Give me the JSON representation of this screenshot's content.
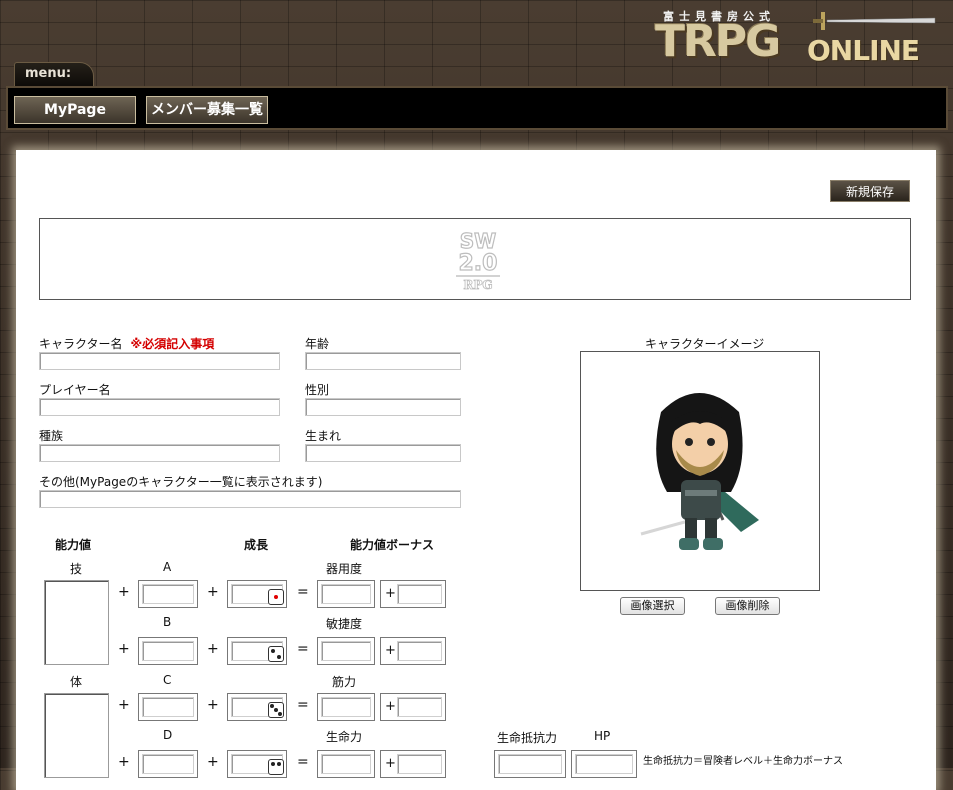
{
  "header": {
    "logo_sub": "富士見書房公式",
    "logo_main": "TRPG",
    "logo_online": "ONLINE",
    "menu_tab": "menu:"
  },
  "nav": {
    "mypage": "MyPage",
    "recruit": "メンバー募集一覧"
  },
  "toolbar": {
    "save_label": "新規保存"
  },
  "banner": {
    "sw_logo_text": "SW 2.0 RPG"
  },
  "form": {
    "character_name": "キャラクター名",
    "required": "※必須記入事項",
    "age": "年齢",
    "player_name": "プレイヤー名",
    "gender": "性別",
    "race": "種族",
    "birth": "生まれ",
    "other": "その他(MyPageのキャラクター一覧に表示されます)"
  },
  "stats": {
    "heading_ability": "能力値",
    "heading_growth": "成長",
    "heading_bonus": "能力値ボーナス",
    "gi": "技",
    "tai": "体",
    "A": "A",
    "B": "B",
    "C": "C",
    "D": "D",
    "dexterity": "器用度",
    "agility": "敏捷度",
    "strength": "筋力",
    "vitality": "生命力",
    "plus": "+",
    "equals": "="
  },
  "image": {
    "title": "キャラクターイメージ",
    "select_label": "画像選択",
    "delete_label": "画像削除"
  },
  "vitals": {
    "resist": "生命抵抗力",
    "hp": "HP",
    "formula": "生命抵抗力＝冒険者レベル＋生命力ボーナス"
  },
  "colors": {
    "required": "#d40000",
    "menubar": "#000000",
    "panel": "#ffffff"
  }
}
